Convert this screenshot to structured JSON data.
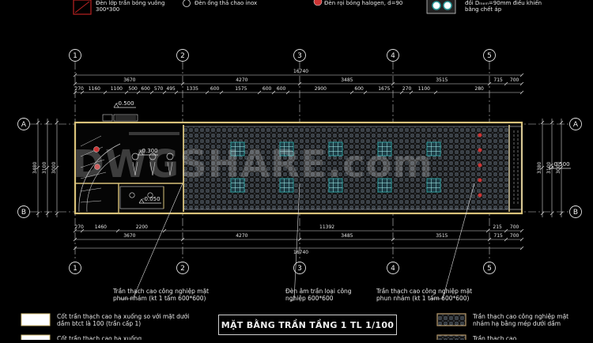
{
  "legend_top": {
    "item1": "Đèn lớp trần bóng vuông 300*300",
    "item2": "Đèn ống thả chao inox",
    "item3": "Đèn rọi bóng halogen, d=90",
    "item4": "đồi Dₘₑₘ=90mm điều khiển bằng chết áp"
  },
  "grid_labels": {
    "columns": [
      "1",
      "2",
      "3",
      "4",
      "5"
    ],
    "rows": [
      "A",
      "B"
    ]
  },
  "dimensions": {
    "overall_top": "16740",
    "spans_top": [
      "3670",
      "4270",
      "3485",
      "3515",
      "715",
      "700"
    ],
    "detail_top": [
      "270",
      "1160",
      "1100",
      "500",
      "600",
      "570",
      "495",
      "1335",
      "600",
      "1575",
      "600",
      "600",
      "2900",
      "600",
      "1675",
      "270",
      "1100",
      "280"
    ],
    "detail_bottom": [
      "270",
      "1460",
      "2200",
      "11392",
      "215",
      "700"
    ],
    "spans_bottom": [
      "3670",
      "4270",
      "3485",
      "3515",
      "715",
      "700"
    ],
    "overall_bottom": "16740",
    "left_side": [
      "3480",
      "3100",
      "3000"
    ],
    "right_side": [
      "3380",
      "3100",
      "3000"
    ]
  },
  "levels": {
    "left_top": "-0.500",
    "center_left": "-0.300",
    "lower_left": "-0.050",
    "right": "-0.500"
  },
  "watermark": "DWGSHARE.com",
  "callouts": {
    "callout1": "Trần thạch cao công nghiệp mặt phun nhám (kt 1 tấm 600*600)",
    "callout2": "Đèn âm trần loại công nghiệp 600*600",
    "callout3": "Trần thạch cao công nghiệp mặt phun nhám (kt 1 tấm 600*600)"
  },
  "legend_bottom": {
    "left1": "Cốt trần thạch cao hạ xuống so với mặt dưới dầm btct là 100 (trần cấp 1)",
    "left2": "Cốt trần thạch cao hạ xuống...",
    "right1": "Trần thạch cao công nghiệp mặt nhám hạ bằng mép dưới dầm",
    "right2": "Trần thạch cao..."
  },
  "drawing_title": "MẶT BẰNG TRẦN TẦNG 1  TL 1/100",
  "colors": {
    "background": "#000000",
    "grid_circle": "#e0e0e0",
    "dim_line": "#d8d8d8",
    "wall": "#d9c27a",
    "pattern": "#7f8fa0",
    "light_fixture": "#2a9a9a",
    "axis_dash": "#c8c8c8",
    "swatch_tan": "#b79a6a"
  }
}
